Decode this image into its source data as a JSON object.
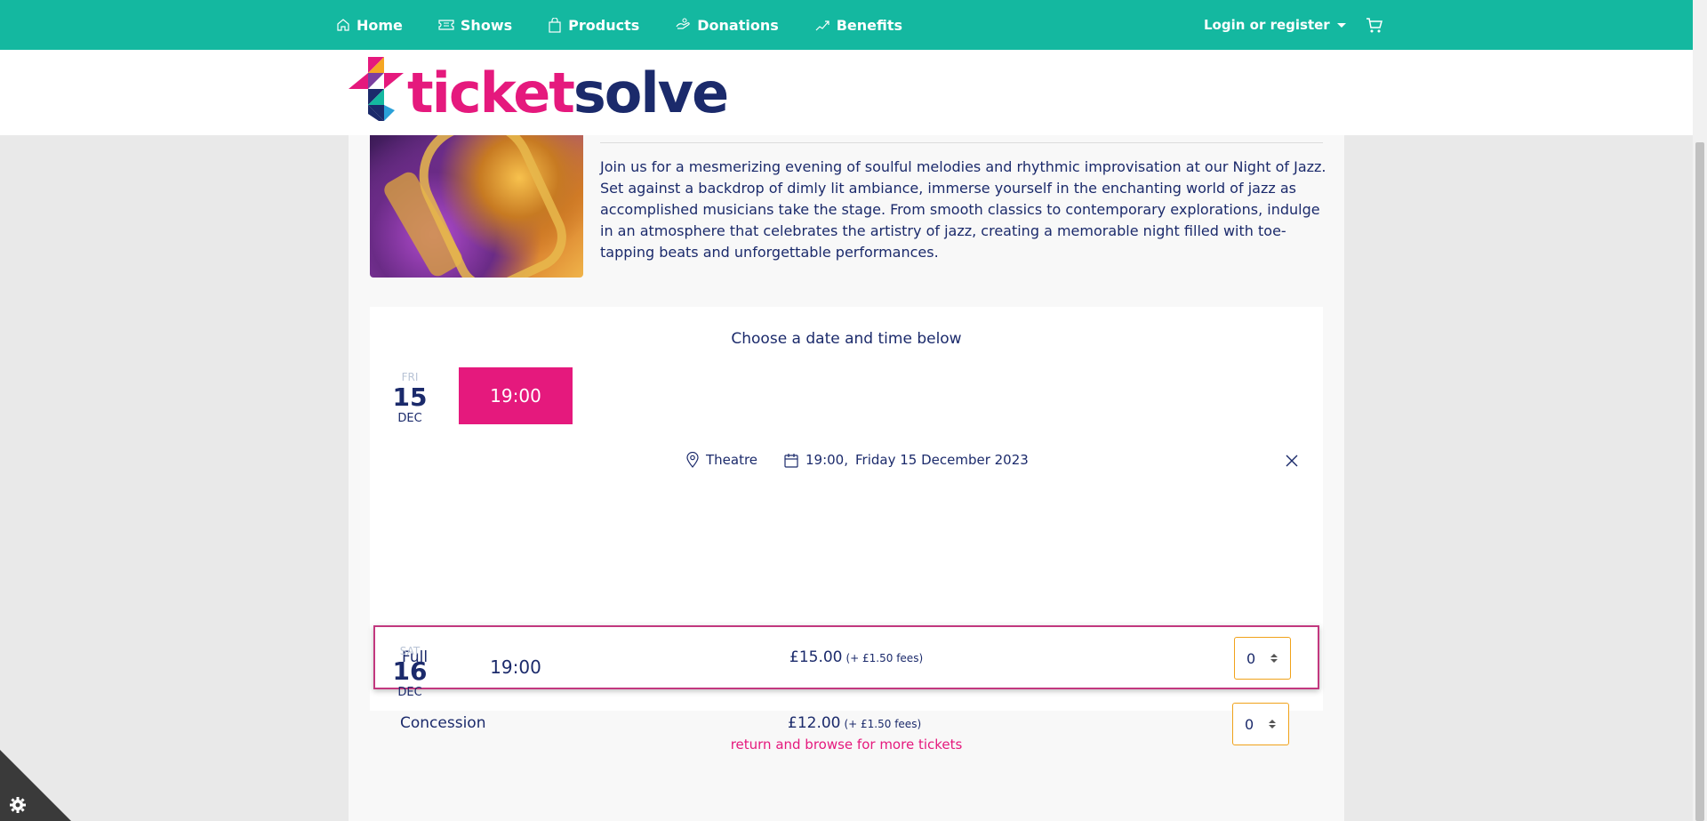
{
  "nav": {
    "items": [
      {
        "label": "Home",
        "icon": "home-icon"
      },
      {
        "label": "Shows",
        "icon": "ticket-icon"
      },
      {
        "label": "Products",
        "icon": "bag-icon"
      },
      {
        "label": "Donations",
        "icon": "donation-icon"
      },
      {
        "label": "Benefits",
        "icon": "benefits-icon"
      }
    ],
    "login_label": "Login or register",
    "cart_icon": "cart-icon"
  },
  "brand": {
    "logo_part1": "ticket",
    "logo_part2": "solve",
    "colors": {
      "teal": "#14b8a0",
      "pink": "#e5197d",
      "navy": "#1b2a6b"
    }
  },
  "event": {
    "description": "Join us for a mesmerizing evening of soulful melodies and rhythmic improvisation at our Night of Jazz. Set against a backdrop of dimly lit ambiance, immerse yourself in the enchanting world of jazz as accomplished musicians take the stage. From smooth classics to contemporary explorations, indulge in an atmosphere that celebrates the artistry of jazz, creating a memorable night filled with toe-tapping beats and unforgettable performances."
  },
  "picker": {
    "title": "Choose a date and time below",
    "dates": [
      {
        "dow": "FRI",
        "day": "15",
        "month": "DEC",
        "time": "19:00"
      },
      {
        "dow": "SAT",
        "day": "16",
        "month": "DEC",
        "time": "19:00"
      }
    ],
    "selected": {
      "venue": "Theatre",
      "time": "19:00,",
      "date": "Friday 15 December 2023"
    },
    "tickets": [
      {
        "name": "Full",
        "price": "£15.00",
        "fees": "(+ £1.50 fees)",
        "qty": "0"
      },
      {
        "name": "Concession",
        "price": "£12.00",
        "fees": "(+ £1.50 fees)",
        "qty": "0"
      }
    ]
  },
  "return_link": "return and browse for more tickets"
}
